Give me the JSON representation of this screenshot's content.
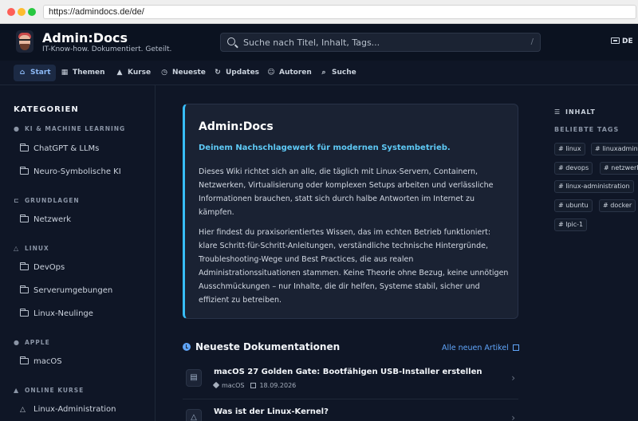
{
  "browser": {
    "url": "https://admindocs.de/de/"
  },
  "header": {
    "title": "Admin:Docs",
    "subtitle": "IT-Know-how. Dokumentiert. Geteilt.",
    "search_placeholder": "Suche nach Titel, Inhalt, Tags...",
    "search_shortcut": "/",
    "language": "DE"
  },
  "nav": {
    "items": [
      {
        "label": "Start",
        "icon": "home-icon"
      },
      {
        "label": "Themen",
        "icon": "grid-icon"
      },
      {
        "label": "Kurse",
        "icon": "course-icon"
      },
      {
        "label": "Neueste",
        "icon": "clock-icon"
      },
      {
        "label": "Updates",
        "icon": "refresh-icon"
      },
      {
        "label": "Autoren",
        "icon": "users-icon"
      },
      {
        "label": "Suche",
        "icon": "search-icon"
      }
    ]
  },
  "sidebar": {
    "heading": "KATEGORIEN",
    "categories": [
      {
        "name": "KI & MACHINE LEARNING",
        "items": [
          "ChatGPT & LLMs",
          "Neuro-Symbolische KI"
        ]
      },
      {
        "name": "GRUNDLAGEN",
        "items": [
          "Netzwerk"
        ]
      },
      {
        "name": "LINUX",
        "items": [
          "DevOps",
          "Serverumgebungen",
          "Linux-Neulinge"
        ]
      },
      {
        "name": "APPLE",
        "items": [
          "macOS"
        ]
      },
      {
        "name": "ONLINE KURSE",
        "items": [
          "Linux-Administration"
        ]
      }
    ]
  },
  "intro": {
    "title": "Admin:Docs",
    "lead": "Deinem Nachschlagewerk für modernen Systembetrieb.",
    "p1": "Dieses Wiki richtet sich an alle, die täglich mit Linux-Servern, Containern, Netzwerken, Virtualisierung oder komplexen Setups arbeiten und verlässliche Informationen brauchen, statt sich durch halbe Antworten im Internet zu kämpfen.",
    "p2": "Hier findest du praxisorientiertes Wissen, das im echten Betrieb funktioniert: klare Schritt-für-Schritt-Anleitungen, verständliche technische Hintergründe, Troubleshooting-Wege und Best Practices, die aus realen Administrationssituationen stammen. Keine Theorie ohne Bezug, keine unnötigen Ausschmückungen – nur Inhalte, die dir helfen, Systeme stabil, sicher und effizient zu betreiben."
  },
  "latest": {
    "heading": "Neueste Dokumentationen",
    "all_link": "Alle neuen Artikel",
    "docs": [
      {
        "title": "macOS 27 Golden Gate: Bootfähigen USB-Installer erstellen",
        "tag": "macOS",
        "date": "18.09.2026",
        "icon": "document-icon"
      },
      {
        "title": "Was ist der Linux-Kernel?",
        "tag": "",
        "date": "",
        "icon": "linux-icon"
      }
    ]
  },
  "toc": {
    "heading": "INHALT"
  },
  "tags": {
    "heading": "BELIEBTE TAGS",
    "items": [
      "# linux",
      "# linuxadmin",
      "# devops",
      "# netzwerk",
      "# linux-administration",
      "# ubuntu",
      "# docker",
      "# lpic-1"
    ]
  }
}
